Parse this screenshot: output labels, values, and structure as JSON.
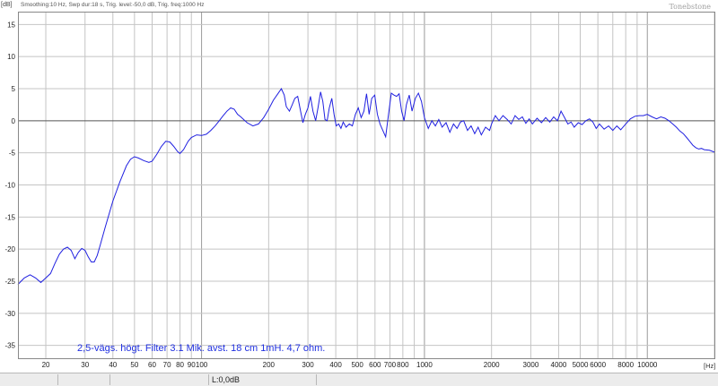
{
  "chart_data": {
    "type": "line",
    "header_info": "Smoothing:10 Hz, Swp dur:18 s, Trig. level:-50,0 dB, Trig. freq:1000 Hz",
    "watermark": "Tonebstone",
    "ylabel": "[dB]",
    "xlabel": "[Hz]",
    "annotation": "2,5-vägs. högt. Filter 3.1 Mik. avst. 18 cm 1mH. 4,7 ohm.",
    "x_scale": "log",
    "xlim": [
      15,
      20000
    ],
    "ylim": [
      -37,
      17
    ],
    "grid": true,
    "y_ticks": [
      15,
      10,
      5,
      0,
      -5,
      -10,
      -15,
      -20,
      -25,
      -30,
      -35
    ],
    "x_ticks": [
      {
        "value": 20,
        "label": "20"
      },
      {
        "value": 30,
        "label": "30"
      },
      {
        "value": 40,
        "label": "40"
      },
      {
        "value": 50,
        "label": "50"
      },
      {
        "value": 60,
        "label": "60"
      },
      {
        "value": 70,
        "label": "70"
      },
      {
        "value": 80,
        "label": "80"
      },
      {
        "value": 90,
        "label": "90"
      },
      {
        "value": 100,
        "label": "100"
      },
      {
        "value": 200,
        "label": "200"
      },
      {
        "value": 300,
        "label": "300"
      },
      {
        "value": 400,
        "label": "400"
      },
      {
        "value": 500,
        "label": "500"
      },
      {
        "value": 600,
        "label": "600"
      },
      {
        "value": 700,
        "label": "700"
      },
      {
        "value": 800,
        "label": "800"
      },
      {
        "value": 1000,
        "label": "1000"
      },
      {
        "value": 2000,
        "label": "2000"
      },
      {
        "value": 3000,
        "label": "3000"
      },
      {
        "value": 4000,
        "label": "4000"
      },
      {
        "value": 5000,
        "label": "5000"
      },
      {
        "value": 6000,
        "label": "6000"
      },
      {
        "value": 8000,
        "label": "8000"
      },
      {
        "value": 10000,
        "label": "10000"
      }
    ],
    "colors": {
      "line": "#2020e0",
      "grid": "#c4c4c4",
      "annotation": "#2030e0"
    },
    "series": [
      {
        "points": [
          [
            15,
            -25.5
          ],
          [
            16,
            -24.5
          ],
          [
            17,
            -24
          ],
          [
            18,
            -24.5
          ],
          [
            19,
            -25.2
          ],
          [
            20,
            -24.5
          ],
          [
            21,
            -23.8
          ],
          [
            22,
            -22.2
          ],
          [
            23,
            -20.8
          ],
          [
            24,
            -20
          ],
          [
            25,
            -19.7
          ],
          [
            26,
            -20.2
          ],
          [
            27,
            -21.5
          ],
          [
            28,
            -20.5
          ],
          [
            29,
            -19.9
          ],
          [
            30,
            -20.2
          ],
          [
            31,
            -21.2
          ],
          [
            32,
            -22
          ],
          [
            33,
            -22
          ],
          [
            34,
            -21
          ],
          [
            35,
            -19.5
          ],
          [
            37,
            -16.5
          ],
          [
            40,
            -12.5
          ],
          [
            43,
            -9.5
          ],
          [
            46,
            -7
          ],
          [
            48,
            -6
          ],
          [
            50,
            -5.6
          ],
          [
            52,
            -5.8
          ],
          [
            55,
            -6.2
          ],
          [
            58,
            -6.5
          ],
          [
            60,
            -6.3
          ],
          [
            63,
            -5.2
          ],
          [
            66,
            -4
          ],
          [
            69,
            -3.2
          ],
          [
            72,
            -3.3
          ],
          [
            75,
            -4
          ],
          [
            78,
            -4.8
          ],
          [
            80,
            -5.1
          ],
          [
            83,
            -4.5
          ],
          [
            87,
            -3.2
          ],
          [
            90,
            -2.6
          ],
          [
            95,
            -2.2
          ],
          [
            100,
            -2.3
          ],
          [
            105,
            -2.1
          ],
          [
            110,
            -1.5
          ],
          [
            115,
            -0.8
          ],
          [
            120,
            0
          ],
          [
            125,
            0.8
          ],
          [
            130,
            1.5
          ],
          [
            135,
            2
          ],
          [
            140,
            1.8
          ],
          [
            145,
            1
          ],
          [
            150,
            0.6
          ],
          [
            160,
            -0.3
          ],
          [
            170,
            -0.8
          ],
          [
            180,
            -0.5
          ],
          [
            190,
            0.5
          ],
          [
            200,
            1.8
          ],
          [
            210,
            3.2
          ],
          [
            220,
            4.2
          ],
          [
            228,
            5.0
          ],
          [
            235,
            4.0
          ],
          [
            240,
            2.2
          ],
          [
            248,
            1.5
          ],
          [
            255,
            2.5
          ],
          [
            262,
            3.5
          ],
          [
            270,
            3.8
          ],
          [
            278,
            1.5
          ],
          [
            285,
            -0.3
          ],
          [
            292,
            1.0
          ],
          [
            300,
            2.0
          ],
          [
            308,
            3.8
          ],
          [
            316,
            1.5
          ],
          [
            325,
            0.0
          ],
          [
            333,
            2.0
          ],
          [
            342,
            4.5
          ],
          [
            350,
            3.0
          ],
          [
            358,
            0.2
          ],
          [
            366,
            0.0
          ],
          [
            374,
            2.0
          ],
          [
            384,
            3.5
          ],
          [
            393,
            1.0
          ],
          [
            402,
            -0.8
          ],
          [
            412,
            -0.5
          ],
          [
            422,
            -1.2
          ],
          [
            432,
            -0.2
          ],
          [
            445,
            -1.0
          ],
          [
            460,
            -0.5
          ],
          [
            475,
            -0.8
          ],
          [
            490,
            1.0
          ],
          [
            505,
            2.0
          ],
          [
            520,
            0.5
          ],
          [
            535,
            1.5
          ],
          [
            550,
            4.2
          ],
          [
            565,
            1.0
          ],
          [
            580,
            3.5
          ],
          [
            598,
            4.0
          ],
          [
            615,
            1.0
          ],
          [
            632,
            -0.5
          ],
          [
            650,
            -1.5
          ],
          [
            670,
            -2.5
          ],
          [
            690,
            1.0
          ],
          [
            710,
            4.3
          ],
          [
            730,
            4.0
          ],
          [
            750,
            3.8
          ],
          [
            770,
            4.2
          ],
          [
            790,
            1.5
          ],
          [
            810,
            0.0
          ],
          [
            830,
            2.5
          ],
          [
            855,
            4.0
          ],
          [
            880,
            1.5
          ],
          [
            910,
            3.5
          ],
          [
            940,
            4.3
          ],
          [
            970,
            3.0
          ],
          [
            1000,
            0.5
          ],
          [
            1040,
            -1.2
          ],
          [
            1080,
            0.0
          ],
          [
            1120,
            -0.8
          ],
          [
            1160,
            0.2
          ],
          [
            1200,
            -1.0
          ],
          [
            1250,
            -0.3
          ],
          [
            1300,
            -1.8
          ],
          [
            1350,
            -0.5
          ],
          [
            1400,
            -1.2
          ],
          [
            1450,
            -0.2
          ],
          [
            1500,
            0.0
          ],
          [
            1560,
            -1.5
          ],
          [
            1620,
            -0.8
          ],
          [
            1680,
            -2.0
          ],
          [
            1740,
            -1.0
          ],
          [
            1800,
            -2.2
          ],
          [
            1880,
            -1.0
          ],
          [
            1960,
            -1.5
          ],
          [
            2000,
            -0.5
          ],
          [
            2080,
            0.8
          ],
          [
            2160,
            0.0
          ],
          [
            2250,
            0.8
          ],
          [
            2350,
            0.2
          ],
          [
            2450,
            -0.5
          ],
          [
            2550,
            0.8
          ],
          [
            2650,
            0.2
          ],
          [
            2750,
            0.6
          ],
          [
            2850,
            -0.4
          ],
          [
            2950,
            0.3
          ],
          [
            3050,
            -0.5
          ],
          [
            3200,
            0.4
          ],
          [
            3350,
            -0.3
          ],
          [
            3500,
            0.5
          ],
          [
            3650,
            -0.2
          ],
          [
            3800,
            0.6
          ],
          [
            3950,
            0.0
          ],
          [
            4100,
            1.5
          ],
          [
            4250,
            0.5
          ],
          [
            4400,
            -0.5
          ],
          [
            4550,
            -0.2
          ],
          [
            4700,
            -1.0
          ],
          [
            4900,
            -0.3
          ],
          [
            5100,
            -0.6
          ],
          [
            5300,
            0.0
          ],
          [
            5500,
            0.3
          ],
          [
            5700,
            -0.2
          ],
          [
            5900,
            -1.2
          ],
          [
            6100,
            -0.5
          ],
          [
            6400,
            -1.3
          ],
          [
            6700,
            -0.8
          ],
          [
            7000,
            -1.5
          ],
          [
            7300,
            -0.8
          ],
          [
            7600,
            -1.4
          ],
          [
            8000,
            -0.5
          ],
          [
            8400,
            0.3
          ],
          [
            8800,
            0.7
          ],
          [
            9200,
            0.8
          ],
          [
            9600,
            0.8
          ],
          [
            10000,
            1.0
          ],
          [
            10500,
            0.6
          ],
          [
            11000,
            0.3
          ],
          [
            11500,
            0.6
          ],
          [
            12000,
            0.4
          ],
          [
            12500,
            0.0
          ],
          [
            13000,
            -0.5
          ],
          [
            13500,
            -1.0
          ],
          [
            14000,
            -1.6
          ],
          [
            14500,
            -2.0
          ],
          [
            15000,
            -2.6
          ],
          [
            15500,
            -3.2
          ],
          [
            16000,
            -3.8
          ],
          [
            16500,
            -4.2
          ],
          [
            17000,
            -4.4
          ],
          [
            17500,
            -4.3
          ],
          [
            18000,
            -4.5
          ],
          [
            19000,
            -4.6
          ],
          [
            20000,
            -4.9
          ]
        ]
      }
    ]
  },
  "status_bar": {
    "readout": "L:0,0dB"
  }
}
